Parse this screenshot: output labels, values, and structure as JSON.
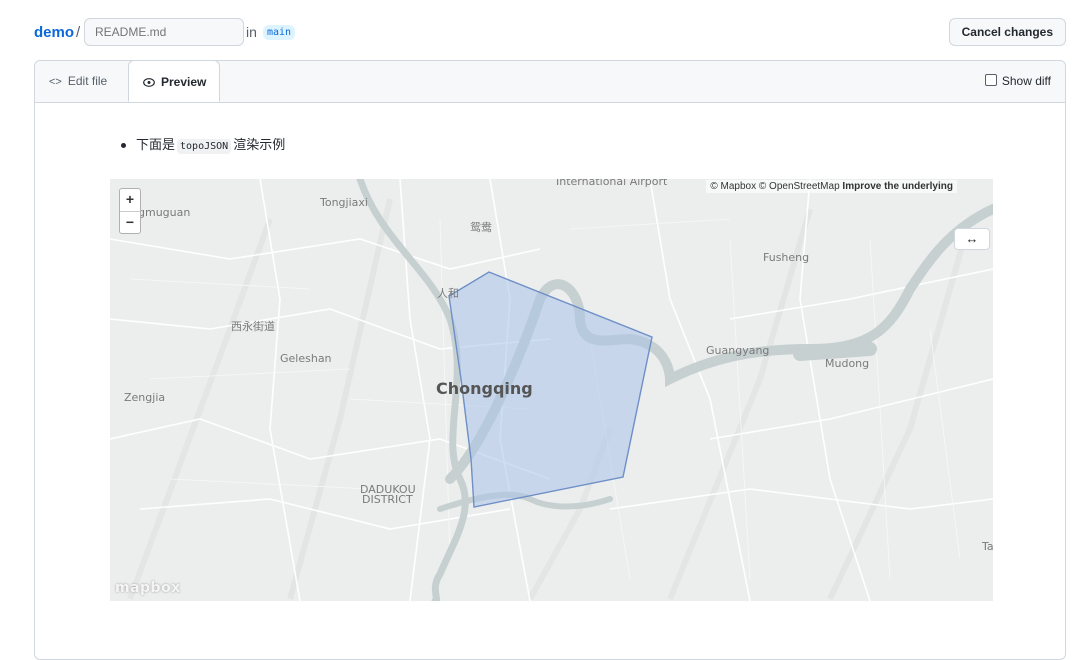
{
  "header": {
    "repo": "demo",
    "separator": "/",
    "filename_placeholder": "README.md",
    "in_text": "in",
    "branch": "main",
    "cancel_label": "Cancel changes"
  },
  "tabs": {
    "edit_icon": "<>",
    "edit_label": "Edit file",
    "preview_icon": "eye-icon",
    "preview_label": "Preview",
    "show_diff_label": "Show diff"
  },
  "preview": {
    "bullet_prefix": "下面是",
    "bullet_code": "topoJSON",
    "bullet_suffix": "渲染示例",
    "expand_icon": "↔"
  },
  "map": {
    "attribution_prefix": "© Mapbox © OpenStreetMap",
    "attribution_link": "Improve the underlying",
    "zoom_in": "+",
    "zoom_out": "−",
    "logo": "mapbox",
    "labels": {
      "airport": "International Airport",
      "tongjiaxi": "Tongjiaxi",
      "jiangbei": "鸳鸯",
      "fusheng": "Fusheng",
      "renhe": "人和",
      "xiyongjiedao": "西永街道",
      "geleshan": "Geleshan",
      "guangyang": "Guangyang",
      "mudong": "Mudong",
      "chongqing": "Chongqing",
      "zengjia": "Zengjia",
      "dadukou1": "DADUKOU",
      "dadukou2": "DISTRICT",
      "muguan": "gmuguan",
      "ta": "Ta"
    },
    "polygon_fill": "#a9c2e8",
    "polygon_stroke": "#6e8fc7"
  }
}
